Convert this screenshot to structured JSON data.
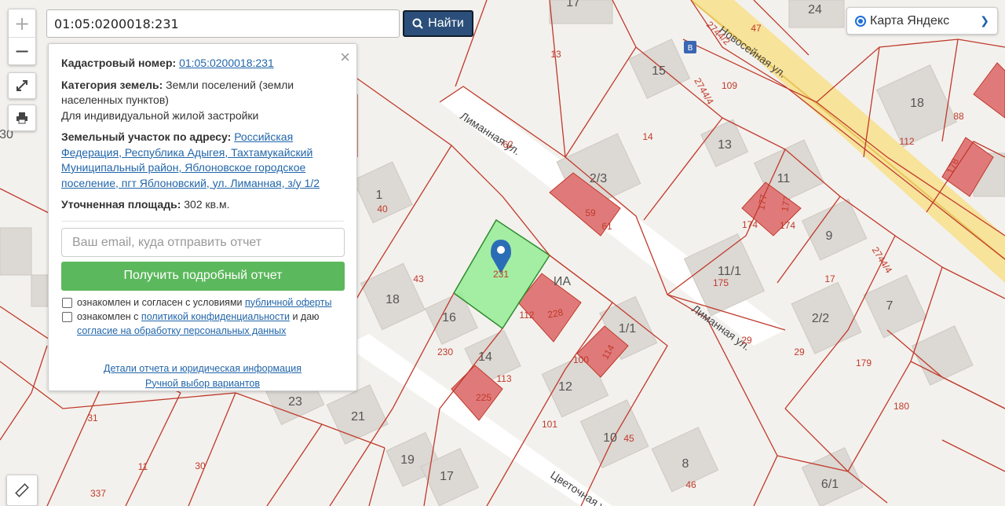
{
  "search": {
    "value": "01:05:0200018:231",
    "button_label": "Найти"
  },
  "layer": {
    "selected": "Карта Яндекс"
  },
  "zoom": {
    "in": "+",
    "out": "−"
  },
  "panel": {
    "cadastral_label": "Кадастровый номер:",
    "cadastral_value": "01:05:0200018:231",
    "category_label": "Категория земель:",
    "category_value": "Земли поселений (земли населенных пунктов)",
    "usage": "Для индивидуальной жилой застройки",
    "address_label": "Земельный участок по адресу:",
    "address_value": "Российская Федерация, Республика Адыгея, Тахтамукайский Муниципальный район, Яблоновское городское поселение, пгт Яблоновский, ул. Лиманная, з/у 1/2",
    "area_label": "Уточненная площадь:",
    "area_value": "302 кв.м.",
    "email_placeholder": "Ваш email, куда отправить отчет",
    "report_button": "Получить подробный отчет",
    "check1_text": "ознакомлен и согласен с условиями",
    "check1_link": "публичной оферты",
    "check2_text_a": "ознакомлен с",
    "check2_link_a": "политикой конфиденциальности",
    "check2_text_b": "и даю",
    "check2_link_b": "согласие на обработку персональных данных",
    "link_details": "Детали отчета и юридическая информация",
    "link_manual": "Ручной выбор вариантов"
  },
  "map": {
    "streets": [
      "Лиманная ул.",
      "Лиманная ул.",
      "Цветочная ул.",
      "Новосейная ул."
    ],
    "parcel_numbers": [
      "13",
      "14",
      "109",
      "62",
      "59",
      "61",
      "40",
      "43",
      "231",
      "112",
      "228",
      "230",
      "113",
      "225",
      "100",
      "114",
      "101",
      "45",
      "46",
      "174",
      "174",
      "175",
      "17",
      "29",
      "179",
      "180",
      "88",
      "112",
      "178",
      "177",
      "177",
      "2744/2",
      "2744/4",
      "2744/4",
      "29",
      "30",
      "31",
      "11",
      "30",
      "337",
      "47"
    ],
    "house_numbers": [
      "17",
      "24",
      "15",
      "13",
      "18",
      "2/3",
      "11",
      "1",
      "9",
      "11/1",
      "18",
      "16",
      "14",
      "12",
      "1/1",
      "10",
      "8",
      "2/2",
      "7",
      "23",
      "21",
      "19",
      "17",
      "6/1",
      "30",
      "ИА"
    ],
    "selected_parcel": "231"
  }
}
